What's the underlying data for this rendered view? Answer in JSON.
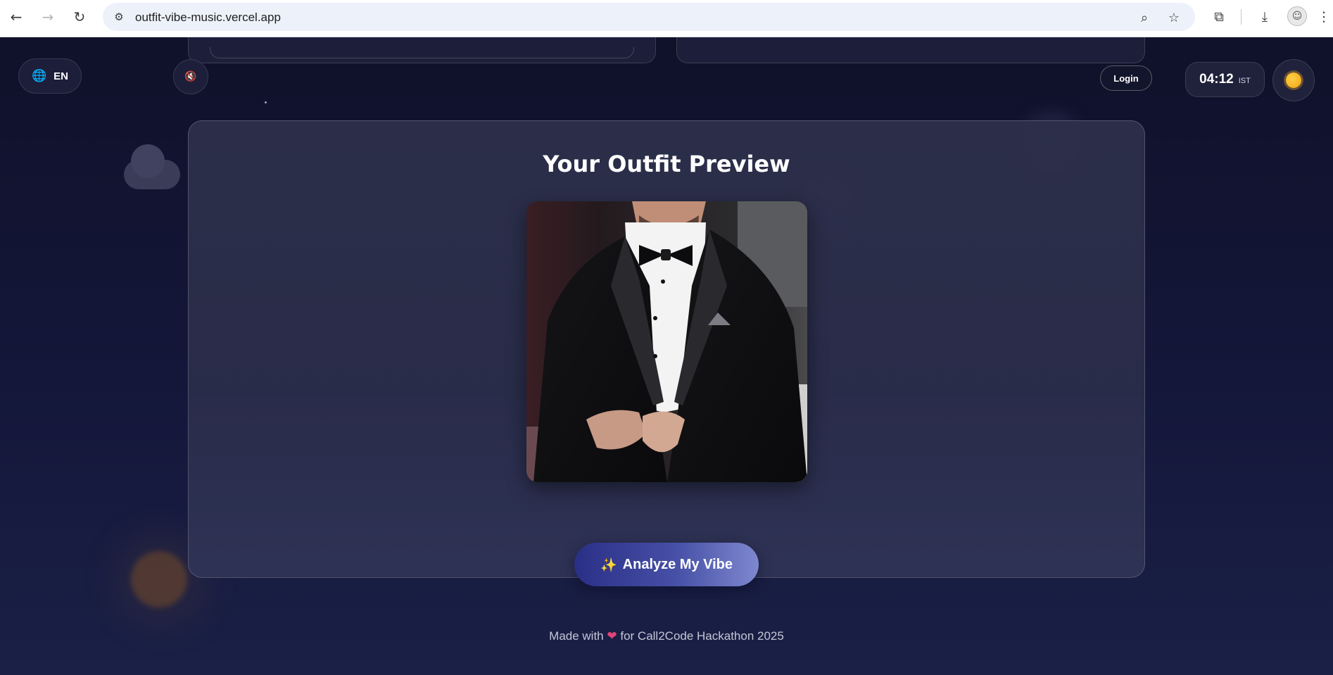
{
  "browser": {
    "url": "outfit-vibe-music.vercel.app",
    "back_icon": "arrow-left-icon",
    "forward_icon": "arrow-right-icon",
    "reload_icon": "reload-icon"
  },
  "header": {
    "language": "EN",
    "login_label": "Login",
    "clock_time": "04:12",
    "clock_zone": "IST"
  },
  "preview": {
    "title": "Your Outfit Preview",
    "analyze_label": "Analyze My Vibe",
    "analyze_icon": "✨"
  },
  "footer": {
    "text_before": "Made with",
    "heart": "❤",
    "text_after": "for Call2Code Hackathon 2025"
  },
  "colors": {
    "background": "#12132a",
    "card": "#2e304b",
    "accent": "#4650a6",
    "sun": "#f3a214"
  }
}
